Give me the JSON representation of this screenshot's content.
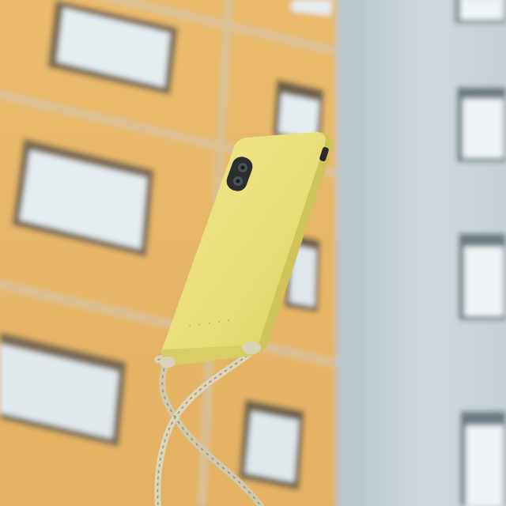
{
  "scene": {
    "description_free": true,
    "phone_case_branding": "",
    "colors": {
      "yellow_building": "#e8b968",
      "yellow_building_shadow": "#d9a656",
      "grey_building": "#c8d4d9",
      "grey_building_shadow": "#b7c3c8",
      "window_glass": "#e6eef2",
      "window_frame": "#8a7a5c",
      "case_yellow": "#ece27e",
      "case_edge": "#d7cc63",
      "cord": "#d8d2b8"
    }
  }
}
